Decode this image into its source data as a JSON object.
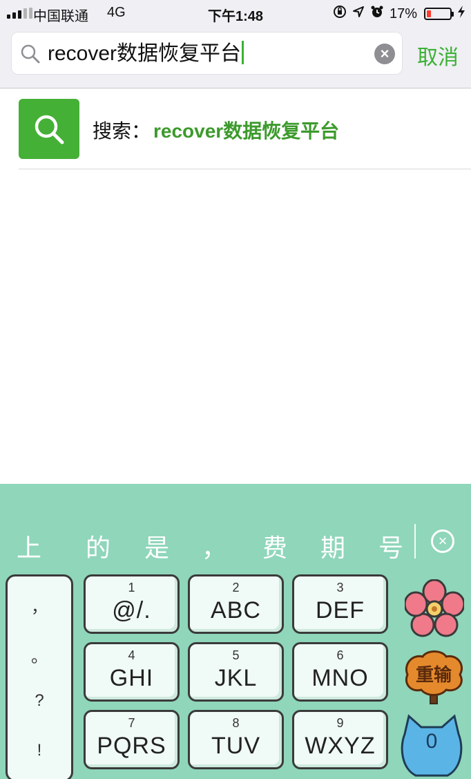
{
  "status_bar": {
    "carrier": "中国联通",
    "network": "4G",
    "time": "下午1:48",
    "battery_percent": "17%",
    "icons": [
      "signal-icon",
      "orientation-lock-icon",
      "location-icon",
      "alarm-icon",
      "battery-icon",
      "charging-icon"
    ]
  },
  "search": {
    "query": "recover数据恢复平台",
    "cancel_label": "取消",
    "clear_icon": "clear-icon"
  },
  "suggestion": {
    "prefix": "搜索：",
    "query": "recover数据恢复平台",
    "icon": "search-icon",
    "icon_color": "#45b036"
  },
  "keyboard": {
    "background": "#8fd6ba",
    "candidates": [
      "上",
      "的",
      "是",
      "，",
      "费",
      "期",
      "号"
    ],
    "punctuation": [
      "，",
      "。",
      "?",
      "!"
    ],
    "keys": [
      {
        "num": "1",
        "letters": "@/."
      },
      {
        "num": "2",
        "letters": "ABC"
      },
      {
        "num": "3",
        "letters": "DEF"
      },
      {
        "num": "4",
        "letters": "GHI"
      },
      {
        "num": "5",
        "letters": "JKL"
      },
      {
        "num": "6",
        "letters": "MNO"
      },
      {
        "num": "7",
        "letters": "PQRS"
      },
      {
        "num": "8",
        "letters": "TUV"
      },
      {
        "num": "9",
        "letters": "WXYZ"
      }
    ],
    "reset_label": "重输",
    "zero_label": "0"
  },
  "colors": {
    "accent_green": "#3cb034",
    "link_green": "#3c9a2c"
  }
}
